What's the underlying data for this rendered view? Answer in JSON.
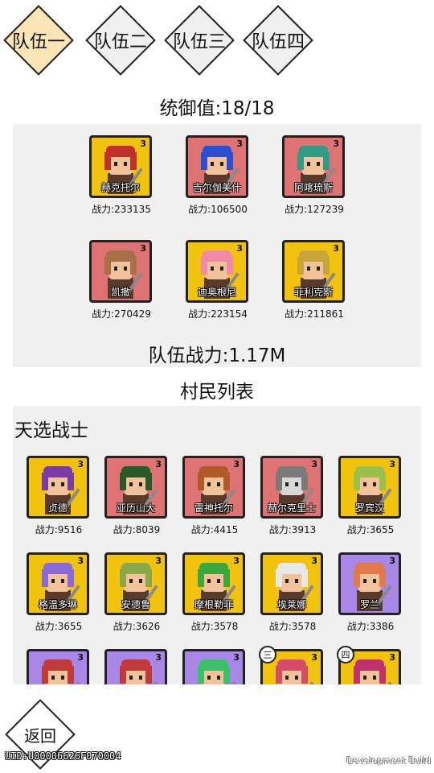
{
  "tabs": [
    {
      "label": "队伍一",
      "active": true
    },
    {
      "label": "队伍二",
      "active": false
    },
    {
      "label": "队伍三",
      "active": false
    },
    {
      "label": "队伍四",
      "active": false
    }
  ],
  "command_value": "统御值:18/18",
  "team": [
    {
      "name": "赫克托尔",
      "power": "战力:233135",
      "stars": "3",
      "bg": "gold",
      "hair": "#c0302a",
      "skin": "#f2c29b"
    },
    {
      "name": "吉尔伽美什",
      "power": "战力:106500",
      "stars": "3",
      "bg": "red",
      "hair": "#2a4fd0",
      "skin": "#f2c29b"
    },
    {
      "name": "阿喀琉斯",
      "power": "战力:127239",
      "stars": "3",
      "bg": "red",
      "hair": "#2f9c86",
      "skin": "#f2c29b"
    },
    {
      "name": "凯撒",
      "power": "战力:270429",
      "stars": "3",
      "bg": "red",
      "hair": "#a8704a",
      "skin": "#f2c29b"
    },
    {
      "name": "迪奥根尼",
      "power": "战力:223154",
      "stars": "3",
      "bg": "gold",
      "hair": "#f08aa8",
      "skin": "#f2c29b"
    },
    {
      "name": "菲利克斯",
      "power": "战力:211861",
      "stars": "3",
      "bg": "gold",
      "hair": "#c8a63a",
      "skin": "#f2c29b"
    }
  ],
  "team_power": "队伍战力:1.17M",
  "villager_list_title": "村民列表",
  "section_label": "天选战士",
  "villagers": [
    {
      "name": "贞德",
      "power": "战力:9516",
      "stars": "3",
      "bg": "gold",
      "hair": "#7a3aa8",
      "skin": "#f2c29b"
    },
    {
      "name": "亚历山大",
      "power": "战力:8039",
      "stars": "3",
      "bg": "red",
      "hair": "#2a5a2a",
      "skin": "#f2c29b"
    },
    {
      "name": "雷神托尔",
      "power": "战力:4415",
      "stars": "3",
      "bg": "red",
      "hair": "#b05a2a",
      "skin": "#f2c29b"
    },
    {
      "name": "赫尔克里士",
      "power": "战力:3913",
      "stars": "3",
      "bg": "red",
      "hair": "#7a7a7a",
      "skin": "#d8d8d8"
    },
    {
      "name": "罗宾汉",
      "power": "战力:3655",
      "stars": "3",
      "bg": "gold",
      "hair": "#9ac04a",
      "skin": "#f2c29b"
    },
    {
      "name": "格温多琳",
      "power": "战力:3655",
      "stars": "3",
      "bg": "gold",
      "hair": "#8a6ad8",
      "skin": "#f2c29b"
    },
    {
      "name": "安德鲁",
      "power": "战力:3626",
      "stars": "3",
      "bg": "gold",
      "hair": "#8aa84a",
      "skin": "#f2c29b"
    },
    {
      "name": "摩根勒菲",
      "power": "战力:3578",
      "stars": "3",
      "bg": "gold",
      "hair": "#3aa83a",
      "skin": "#f2c29b"
    },
    {
      "name": "埃莱娜",
      "power": "战力:3578",
      "stars": "3",
      "bg": "gold",
      "hair": "#e8e8e8",
      "skin": "#f2c29b"
    },
    {
      "name": "罗兰",
      "power": "战力:3386",
      "stars": "3",
      "bg": "purple",
      "hair": "#e07a4a",
      "skin": "#f2c29b"
    },
    {
      "name": "",
      "power": "",
      "stars": "3",
      "bg": "purple",
      "hair": "#c03a3a",
      "skin": "#f2c29b"
    },
    {
      "name": "",
      "power": "",
      "stars": "3",
      "bg": "purple",
      "hair": "#c03a3a",
      "skin": "#f2c29b"
    },
    {
      "name": "",
      "power": "",
      "stars": "3",
      "bg": "purple",
      "hair": "#3ac06a",
      "skin": "#f2c29b"
    },
    {
      "name": "",
      "power": "",
      "stars": "3",
      "bg": "gold",
      "hair": "#d84a6a",
      "skin": "#f2c29b",
      "badge": "三"
    },
    {
      "name": "",
      "power": "",
      "stars": "3",
      "bg": "gold",
      "hair": "#c0306a",
      "skin": "#f2c29b",
      "badge": "四"
    }
  ],
  "back_label": "返回",
  "uid": "UID:U00006626F070004",
  "dev_build": "Development Build"
}
